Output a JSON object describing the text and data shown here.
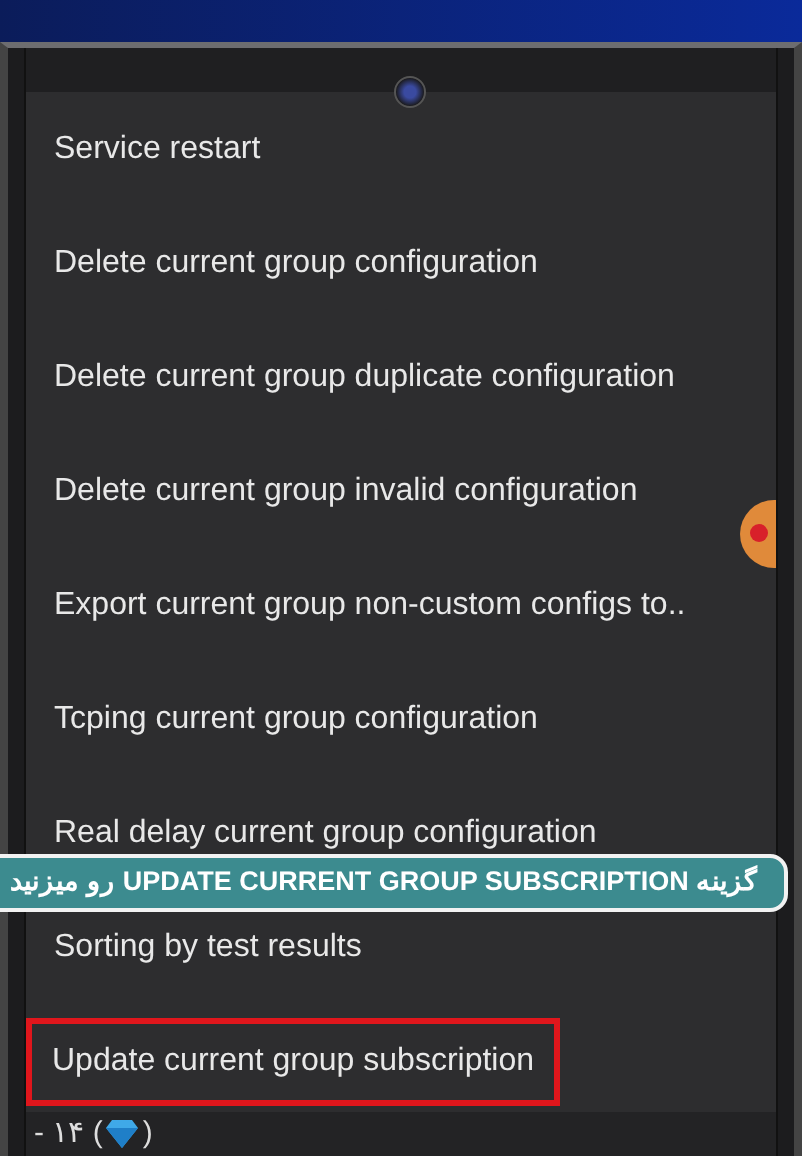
{
  "menu": {
    "items": [
      {
        "label": "Service restart",
        "highlighted": false
      },
      {
        "label": "Delete current group configuration",
        "highlighted": false
      },
      {
        "label": "Delete current group duplicate configuration",
        "highlighted": false
      },
      {
        "label": "Delete current group invalid configuration",
        "highlighted": false
      },
      {
        "label": "Export current group non-custom configs to..",
        "highlighted": false
      },
      {
        "label": "Tcping current group configuration",
        "highlighted": false
      },
      {
        "label": "Real delay current group configuration",
        "highlighted": false
      },
      {
        "label": "Sorting by test results",
        "highlighted": false
      },
      {
        "label": "Update current group subscription",
        "highlighted": true
      }
    ]
  },
  "caption": {
    "text": "گزینه UPDATE CURRENT GROUP SUBSCRIPTION رو میزنید"
  },
  "footer": {
    "prefix": "- ۱۴ (",
    "suffix": ")"
  }
}
